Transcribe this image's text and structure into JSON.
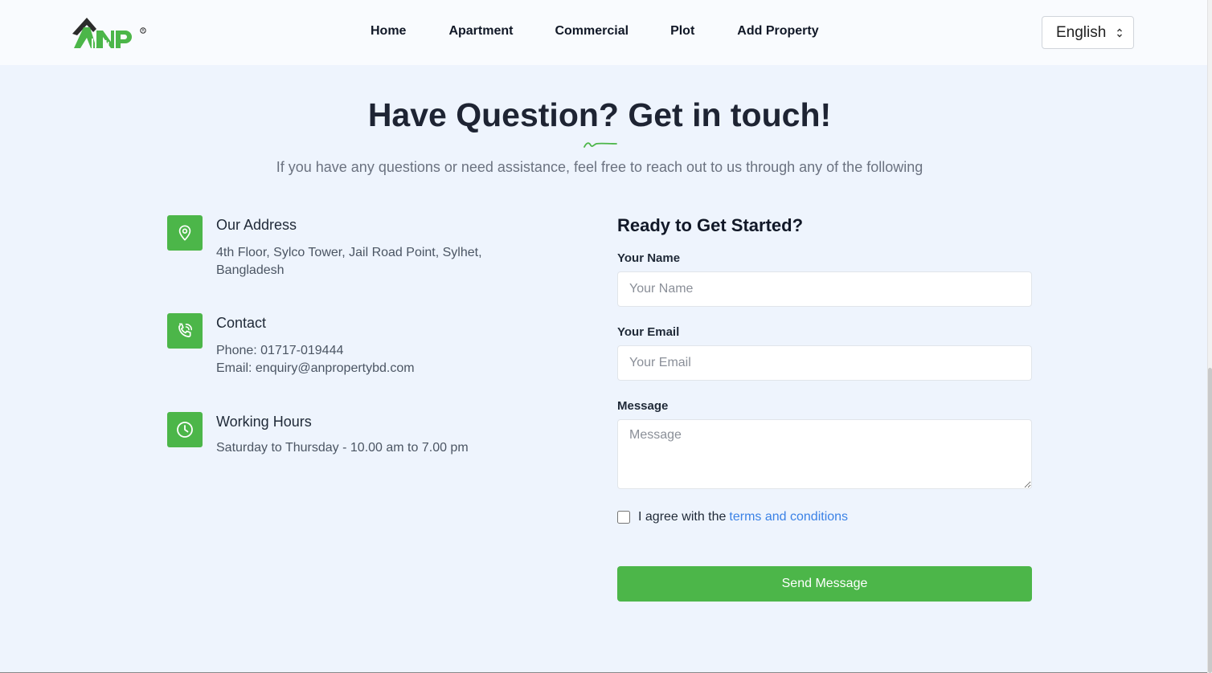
{
  "header": {
    "logo_text": "ANP",
    "nav": [
      "Home",
      "Apartment",
      "Commercial",
      "Plot",
      "Add Property"
    ],
    "language": "English"
  },
  "hero": {
    "title": "Have Question? Get in touch!",
    "subtitle": "If you have any questions or need assistance, feel free to reach out to us through any of the following"
  },
  "info": {
    "address": {
      "title": "Our Address",
      "text": "4th Floor, Sylco Tower, Jail Road Point, Sylhet, Bangladesh"
    },
    "contact": {
      "title": "Contact",
      "phone": "Phone: 01717-019444",
      "email": "Email: enquiry@anpropertybd.com"
    },
    "hours": {
      "title": "Working Hours",
      "text": "Saturday to Thursday - 10.00 am to 7.00 pm"
    }
  },
  "form": {
    "title": "Ready to Get Started?",
    "name_label": "Your Name",
    "name_placeholder": "Your Name",
    "email_label": "Your Email",
    "email_placeholder": "Your Email",
    "message_label": "Message",
    "message_placeholder": "Message",
    "agree_text": "I agree with the",
    "terms_link": "terms and conditions",
    "submit_label": "Send Message"
  },
  "colors": {
    "accent": "#4cb649",
    "link": "#3b82e6",
    "background": "#eef4fd"
  }
}
